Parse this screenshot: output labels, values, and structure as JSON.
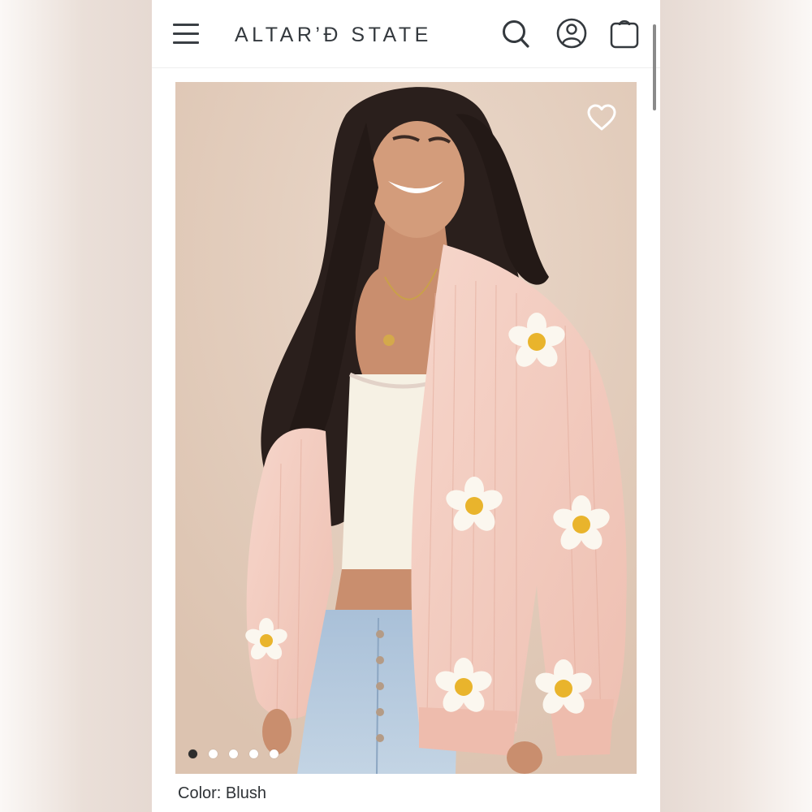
{
  "header": {
    "logo_text": "ALTAR’Ɖ STATE",
    "menu_icon": "hamburger-menu-icon",
    "search_icon": "search-icon",
    "account_icon": "account-icon",
    "bag_icon": "shopping-bag-icon"
  },
  "product": {
    "image_alt": "Blush knit cardigan with daisy appliqués",
    "wishlist_icon": "heart-icon",
    "carousel": {
      "count": 5,
      "active_index": 0
    },
    "color_label": "Color:",
    "color_value": "Blush"
  },
  "colors": {
    "text": "#34393e",
    "background": "#ffffff",
    "photo_backdrop": "#e2cdbd",
    "cardigan": "#f2cbbf",
    "daisy_petal": "#fbf7ef",
    "daisy_center": "#e9b42c"
  }
}
